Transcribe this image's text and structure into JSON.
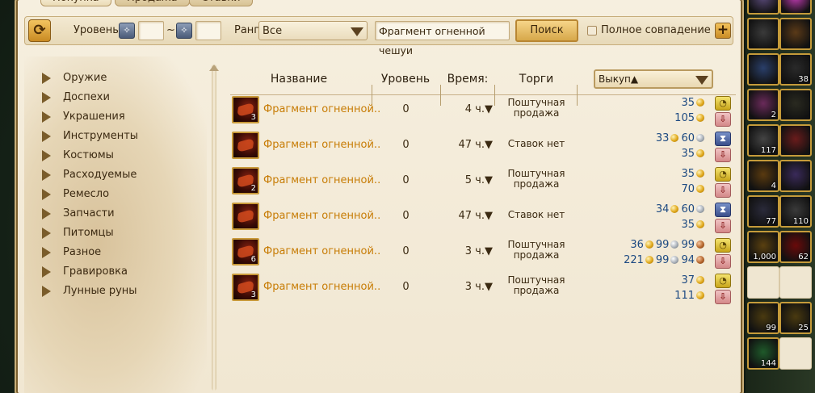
{
  "tabs": [
    {
      "label": "Покупка",
      "active": true
    },
    {
      "label": "Продажа",
      "active": false
    },
    {
      "label": "Ставки",
      "active": false
    }
  ],
  "toolbar": {
    "level_label": "Уровень",
    "level_from": "",
    "tilde": "~",
    "level_to": "",
    "rank_label": "Ранг",
    "rank_value": "Все",
    "search_value": "Фрагмент огненной чешуи",
    "search_button": "Поиск",
    "exact_match_label": "Полное совпадение",
    "exact_match_checked": false
  },
  "categories": [
    "Оружие",
    "Доспехи",
    "Украшения",
    "Инструменты",
    "Костюмы",
    "Расходуемые",
    "Ремесло",
    "Запчасти",
    "Питомцы",
    "Разное",
    "Гравировка",
    "Лунные руны"
  ],
  "table": {
    "headers": {
      "name": "Название",
      "level": "Уровень",
      "time": "Время:",
      "trade": "Торги",
      "buyout": "Выкуп▲"
    },
    "rows": [
      {
        "qty": "3",
        "name": "Фрагмент огненной..",
        "level": "0",
        "time": "4 ч.▼",
        "trade": "Поштучная продажа",
        "bid": {
          "g": "35"
        },
        "buy": {
          "g": "105"
        },
        "bid_icon": "clock-icon"
      },
      {
        "qty": "",
        "name": "Фрагмент огненной..",
        "level": "0",
        "time": "47 ч.▼",
        "trade": "Ставок нет",
        "bid": {
          "g": "33",
          "s": "60"
        },
        "buy": {
          "g": "35"
        },
        "bid_icon": "hourglass-icon"
      },
      {
        "qty": "2",
        "name": "Фрагмент огненной..",
        "level": "0",
        "time": "5 ч.▼",
        "trade": "Поштучная продажа",
        "bid": {
          "g": "35"
        },
        "buy": {
          "g": "70"
        },
        "bid_icon": "clock-icon"
      },
      {
        "qty": "",
        "name": "Фрагмент огненной..",
        "level": "0",
        "time": "47 ч.▼",
        "trade": "Ставок нет",
        "bid": {
          "g": "34",
          "s": "60"
        },
        "buy": {
          "g": "35"
        },
        "bid_icon": "hourglass-icon"
      },
      {
        "qty": "6",
        "name": "Фрагмент огненной..",
        "level": "0",
        "time": "3 ч.▼",
        "trade": "Поштучная продажа",
        "bid": {
          "g": "36",
          "s": "99",
          "c": "99"
        },
        "buy": {
          "g": "221",
          "s": "99",
          "c": "94"
        },
        "bid_icon": "clock-icon"
      },
      {
        "qty": "3",
        "name": "Фрагмент огненной..",
        "level": "0",
        "time": "3 ч.▼",
        "trade": "Поштучная продажа",
        "bid": {
          "g": "37"
        },
        "buy": {
          "g": "111"
        },
        "bid_icon": "clock-icon"
      }
    ]
  },
  "inventory": [
    {
      "qty": "",
      "color": "#5a4a7a"
    },
    {
      "qty": "",
      "color": "#c23bb3"
    },
    {
      "qty": "",
      "color": "#3a3a3a"
    },
    {
      "qty": "",
      "color": "#5b3a18"
    },
    {
      "qty": "",
      "color": "#2a3f6a"
    },
    {
      "qty": "38",
      "color": "#2a2a2a"
    },
    {
      "qty": "2",
      "color": "#6a2a5a"
    },
    {
      "qty": "",
      "color": "#2a2a20"
    },
    {
      "qty": "117",
      "color": "#444"
    },
    {
      "qty": "",
      "color": "#6a1c1c"
    },
    {
      "qty": "4",
      "color": "#5a3a10"
    },
    {
      "qty": "",
      "color": "#3a2a5a"
    },
    {
      "qty": "77",
      "color": "#2a2a3a"
    },
    {
      "qty": "110",
      "color": "#3a3a3a"
    },
    {
      "qty": "1,000",
      "color": "#5a4010"
    },
    {
      "qty": "62",
      "color": "#6a0a0a"
    },
    {
      "qty": "",
      "color": "empty"
    },
    {
      "qty": "",
      "color": "empty"
    },
    {
      "qty": "99",
      "color": "#4a3a10"
    },
    {
      "qty": "25",
      "color": "#4a3a10"
    },
    {
      "qty": "144",
      "color": "#1f5a2a"
    },
    {
      "qty": "",
      "color": "empty"
    }
  ]
}
